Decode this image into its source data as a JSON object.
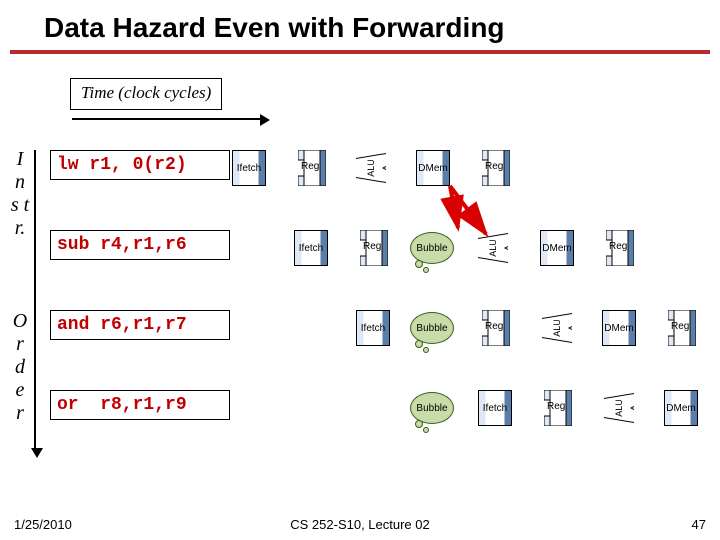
{
  "title": "Data Hazard Even with Forwarding",
  "time_label": "Time (clock cycles)",
  "y_axis": {
    "top": "I\nn\ns\nt\nr.",
    "bottom": "O\nr\nd\ne\nr"
  },
  "instructions": [
    {
      "text": "lw r1, 0(r2)"
    },
    {
      "text": "sub r4,r1,r6"
    },
    {
      "text": "and r6,r1,r7"
    },
    {
      "text": "or  r8,r1,r9"
    }
  ],
  "stage_labels": {
    "ifetch": "Ifetch",
    "reg": "Reg",
    "alu": "ALU",
    "dmem": "DMem",
    "bubble": "Bubble"
  },
  "footer": {
    "date": "1/25/2010",
    "course": "CS 252-S10, Lecture 02",
    "page": "47"
  }
}
